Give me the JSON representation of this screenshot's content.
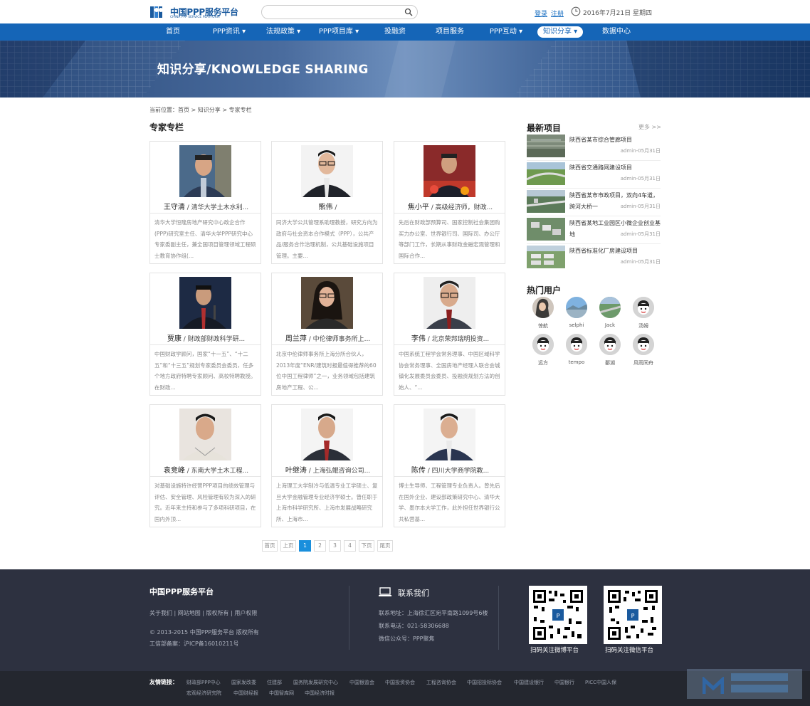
{
  "header": {
    "logo_title": "中国PPP服务平台",
    "logo_subtitle": "CHINA PPP SERVICE PLATFORM",
    "search_placeholder": "",
    "login": "登录",
    "register": "注册",
    "date": "2016年7月21日 星期四"
  },
  "nav": [
    {
      "label": "首页",
      "dropdown": false,
      "active": false
    },
    {
      "label": "PPP资讯",
      "dropdown": true,
      "active": false
    },
    {
      "label": "法规政策",
      "dropdown": true,
      "active": false
    },
    {
      "label": "PPP项目库",
      "dropdown": true,
      "active": false
    },
    {
      "label": "投融资",
      "dropdown": false,
      "active": false
    },
    {
      "label": "项目服务",
      "dropdown": false,
      "active": false
    },
    {
      "label": "PPP互动",
      "dropdown": true,
      "active": false
    },
    {
      "label": "知识分享",
      "dropdown": true,
      "active": true
    },
    {
      "label": "数据中心",
      "dropdown": false,
      "active": false
    }
  ],
  "banner": {
    "title": "知识分享/KNOWLEDGE SHARING"
  },
  "breadcrumb": "当前位置：首页 > 知识分享 > 专家专栏",
  "section_title": "专家专栏",
  "experts": [
    {
      "name": "王守清",
      "title": " / 清华大学土木水利...",
      "desc": "清华大学恒隆房地产研究中心政企合作(PPP)研究室主任、清华大学PPP研究中心专家委副主任，兼全国项目管理领域工程硕士教育协作组(..."
    },
    {
      "name": "熊伟",
      "title": " / ",
      "desc": "同济大学公共管理系助理教授，研究方向为政府与社会资本合作模式（PPP），公共产品/服务合作治理机制，公共基础设施项目管理。主要..."
    },
    {
      "name": "焦小平",
      "title": " / 高级经济师，财政...",
      "desc": "先后在财政部预算司、国家控制社会集团购买力办公室、世界银行司、国际司、办公厅等部门工作，长期从事财政金融宏观管理和国际合作..."
    },
    {
      "name": "贾康",
      "title": " / 财政部财政科学研...",
      "desc": "中国财政学顾问，国家“十一五”、“十二五”和“十三五”规划专家委员会委员，任多个地方政府特聘专家顾问、高校特聘教授。在财政..."
    },
    {
      "name": "周兰萍",
      "title": " / 中伦律师事务所上...",
      "desc": "北京中伦律师事务所上海分所合伙人，2013年度“ENR/建筑时报最值得推荐的60位中国工程律师”之一，业务领域包括建筑房地产工程、公..."
    },
    {
      "name": "李伟",
      "title": " / 北京荣邦瑞明投资...",
      "desc": "中国系统工程学会常务理事、中国区域科学协会常务理事、全国房地产经理人联合会城镇化发展委员会委员、投融资规划方法的创始人、“..."
    },
    {
      "name": "袁竞峰",
      "title": " / 东南大学土木工程...",
      "desc": "对基础设施特许经营PPP项目的绩效管理与评估、安全管理、风险管理有较为深入的研究。近年来主持和参与了多项科研项目，在国内外顶..."
    },
    {
      "name": "叶继涛",
      "title": " / 上海弘鲲咨询公司...",
      "desc": "上海理工大学制冷与低温专业工学硕士、复旦大学金融管理专业经济学硕士。曾任职于上海市科学研究所、上海市发展战略研究所、上海市..."
    },
    {
      "name": "陈传",
      "title": " / 四川大学商学院教...",
      "desc": "博士生导师、工程管理专业负责人。曾先后在国外企业、建设部政策研究中心、清华大学、墨尔本大学工作，此外担任世界银行公共私营基..."
    }
  ],
  "pager": {
    "first": "首页",
    "prev": "上页",
    "pages": [
      "1",
      "2",
      "3",
      "4"
    ],
    "current": "1",
    "next": "下页",
    "last": "尾页"
  },
  "latest": {
    "title": "最新项目",
    "more": "更多 >>",
    "items": [
      {
        "title": "陕西省某市综合管廊项目",
        "meta": "admin-05月31日"
      },
      {
        "title": "陕西省交通路网建设项目",
        "meta": "admin-05月31日"
      },
      {
        "title": "陕西省某市市政项目，双向4车道，跨河大桥一",
        "meta": "admin-05月31日"
      },
      {
        "title": "陕西省某地工业园区小微企业创业基地",
        "meta": "admin-05月31日"
      },
      {
        "title": "陕西省标准化厂房建设项目",
        "meta": "admin-05月31日"
      }
    ]
  },
  "hot_users": {
    "title": "热门用户",
    "users": [
      {
        "name": "惊航",
        "avatar": "photo-woman"
      },
      {
        "name": "selphi",
        "avatar": "photo-landscape"
      },
      {
        "name": "Jack",
        "avatar": "photo-rail"
      },
      {
        "name": "汤姆",
        "avatar": "default"
      },
      {
        "name": "远方",
        "avatar": "default"
      },
      {
        "name": "tempo",
        "avatar": "default"
      },
      {
        "name": "鄱湖",
        "avatar": "default"
      },
      {
        "name": "风雨同舟",
        "avatar": "default"
      }
    ]
  },
  "footer": {
    "title": "中国PPP服务平台",
    "links": "关于我们 | 网站地图 | 版权所有 | 用户权限",
    "copyright": "© 2013-2015 中国PPP服务平台 版权所有",
    "icp": "工信部备案：沪ICP备16010211号",
    "contact_title": "联系我们",
    "address": "联系地址：上海徐汇区宛平南路1099号6楼",
    "phone": "联系电话：021-58306688",
    "wechat": "微信公众号：PPP聚焦",
    "qr1_label": "扫码关注微博平台",
    "qr2_label": "扫码关注微信平台"
  },
  "friend_links": {
    "label": "友情链接：",
    "row1": [
      "财政部PPP中心",
      "国家发改委",
      "住建部",
      "国务院发展研究中心",
      "中国银监会",
      "中国投资协会",
      "工程咨询协会",
      "中国招投标协会",
      "中国建设银行",
      "中国银行",
      "PICC中国人保"
    ],
    "row2": [
      "宏观经济研究院",
      "中国财经报",
      "中国智库网",
      "中国经济时报"
    ]
  },
  "colors": {
    "nav_blue": "#1565b7",
    "footer_bg": "#2d3140",
    "active_page": "#1a8fdc"
  }
}
